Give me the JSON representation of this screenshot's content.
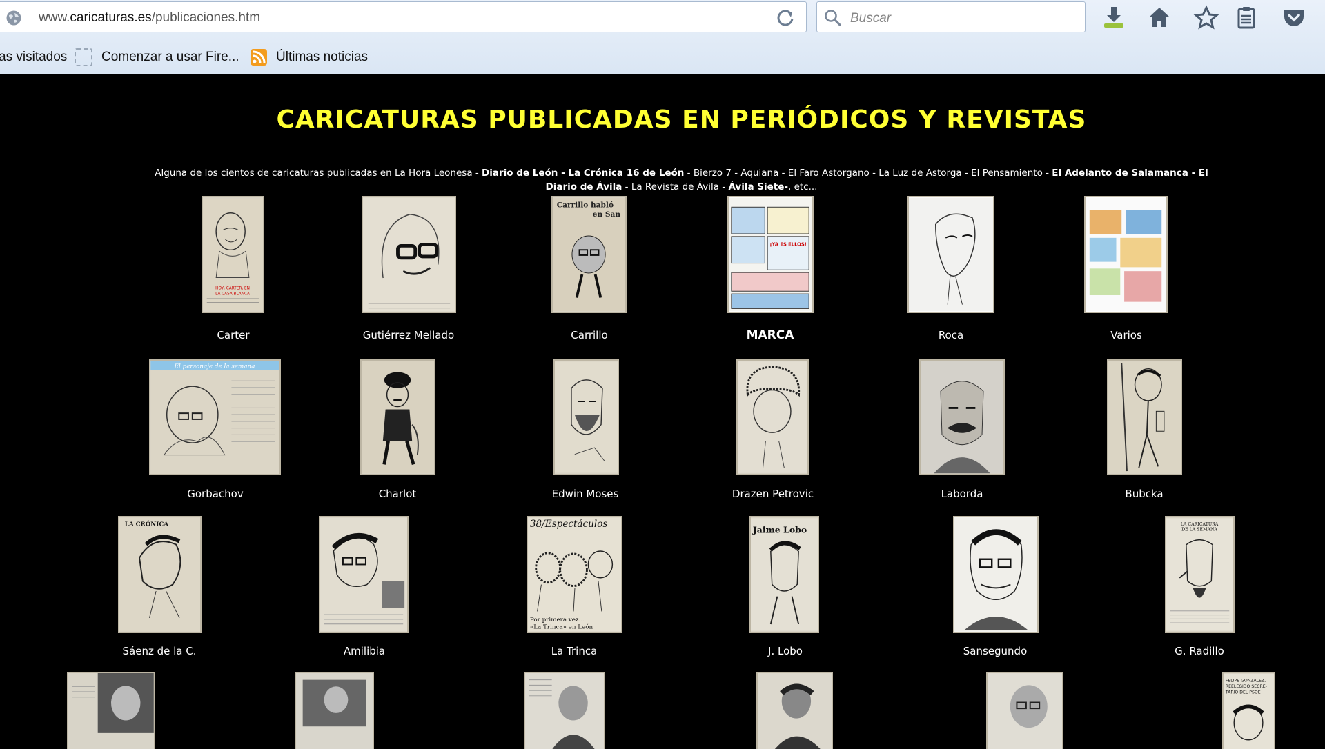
{
  "browser": {
    "url_prefix": "www.",
    "url_host": "caricaturas.es",
    "url_path": "/publicaciones.htm",
    "search_placeholder": "Buscar",
    "bookmarks": [
      "as visitados",
      "Comenzar a usar Fire...",
      "Últimas noticias"
    ]
  },
  "page": {
    "title": "CARICATURAS PUBLICADAS EN PERIÓDICOS Y REVISTAS",
    "intro_parts": [
      {
        "text": "Alguna de los cientos de caricaturas publicadas en La Hora Leonesa - ",
        "bold": false
      },
      {
        "text": "Diario de León - La Crónica 16 de León",
        "bold": true
      },
      {
        "text": " - Bierzo 7 - Aquiana - El Faro Astorgano - La Luz de Astorga - El Pensamiento - ",
        "bold": false
      },
      {
        "text": "El Adelanto de Salamanca - El Diario de Ávila",
        "bold": true
      },
      {
        "text": " - La Revista de Ávila - ",
        "bold": false
      },
      {
        "text": "Ávila Siete-",
        "bold": true
      },
      {
        "text": ", etc...",
        "bold": false
      }
    ],
    "rows": [
      [
        "Carter",
        "Gutiérrez Mellado",
        "Carrillo",
        "MARCA",
        "Roca",
        "Varios"
      ],
      [
        "Gorbachov",
        "Charlot",
        "Edwin Moses",
        "Drazen Petrovic",
        "Laborda",
        "Bubcka"
      ],
      [
        "Sáenz de la C.",
        "Amilibia",
        "La Trinca",
        "J. Lobo",
        "Sansegundo",
        "G. Radillo"
      ]
    ],
    "thumb_texts": {
      "carter": "HOY, CARTER, EN LA CASA BLANCA",
      "carrillo": "Carrillo habló en San",
      "trinca_header": "38/Espectáculos",
      "trinca_caption": "Por primera vez... «La Trinca» en León",
      "lobo_header": "Jaime Lobo",
      "radillo_header": "LA CARICATURA DE LA SEMANA",
      "gorbachov_header": "El personaje de la semana",
      "cronica": "LA CRÓNICA",
      "felipe": "FELIPE GONZALEZ, REELEGIDO SECRE- TARIO DEL PSOE",
      "marca_bubble": "¡YA ES ELLOS!"
    }
  }
}
